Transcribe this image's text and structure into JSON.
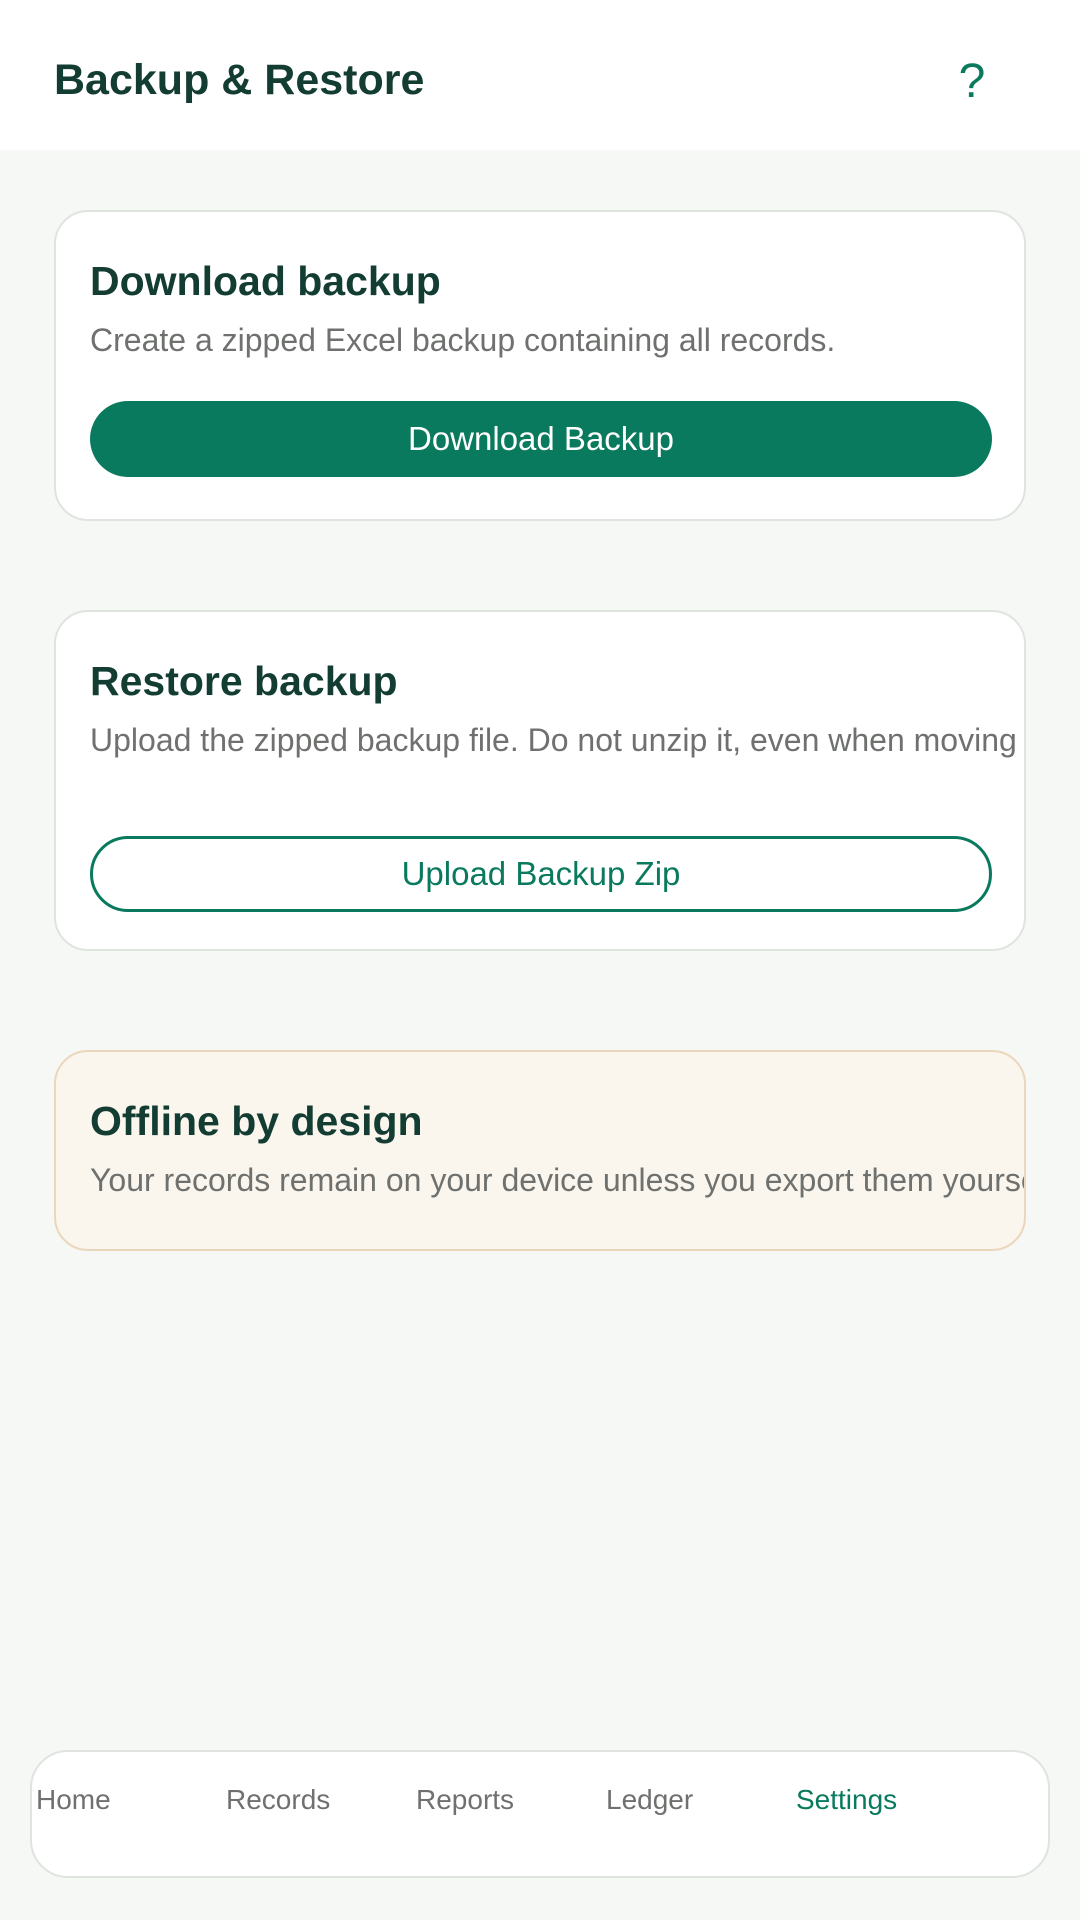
{
  "header": {
    "title": "Backup & Restore",
    "help_label": "?"
  },
  "download_card": {
    "title": "Download backup",
    "description": "Create a zipped Excel backup containing all records.",
    "button_label": "Download Backup"
  },
  "restore_card": {
    "title": "Restore backup",
    "description": "Upload the zipped backup file. Do not unzip it, even when moving",
    "button_label": "Upload Backup Zip"
  },
  "offline_card": {
    "title": "Offline by design",
    "description": "Your records remain on your device unless you export them yourse"
  },
  "bottom_nav": {
    "items": [
      {
        "label": "Home",
        "active": false
      },
      {
        "label": "Records",
        "active": false
      },
      {
        "label": "Reports",
        "active": false
      },
      {
        "label": "Ledger",
        "active": false
      },
      {
        "label": "Settings",
        "active": true
      }
    ]
  },
  "colors": {
    "accent": "#0a7a5e",
    "heading": "#133d33",
    "muted_text": "#6e716e",
    "page_background": "#f6f8f5",
    "offline_card_background": "#faf5ed",
    "offline_card_border": "#ead7bb"
  },
  "icons": {
    "help": "help-question-icon"
  }
}
